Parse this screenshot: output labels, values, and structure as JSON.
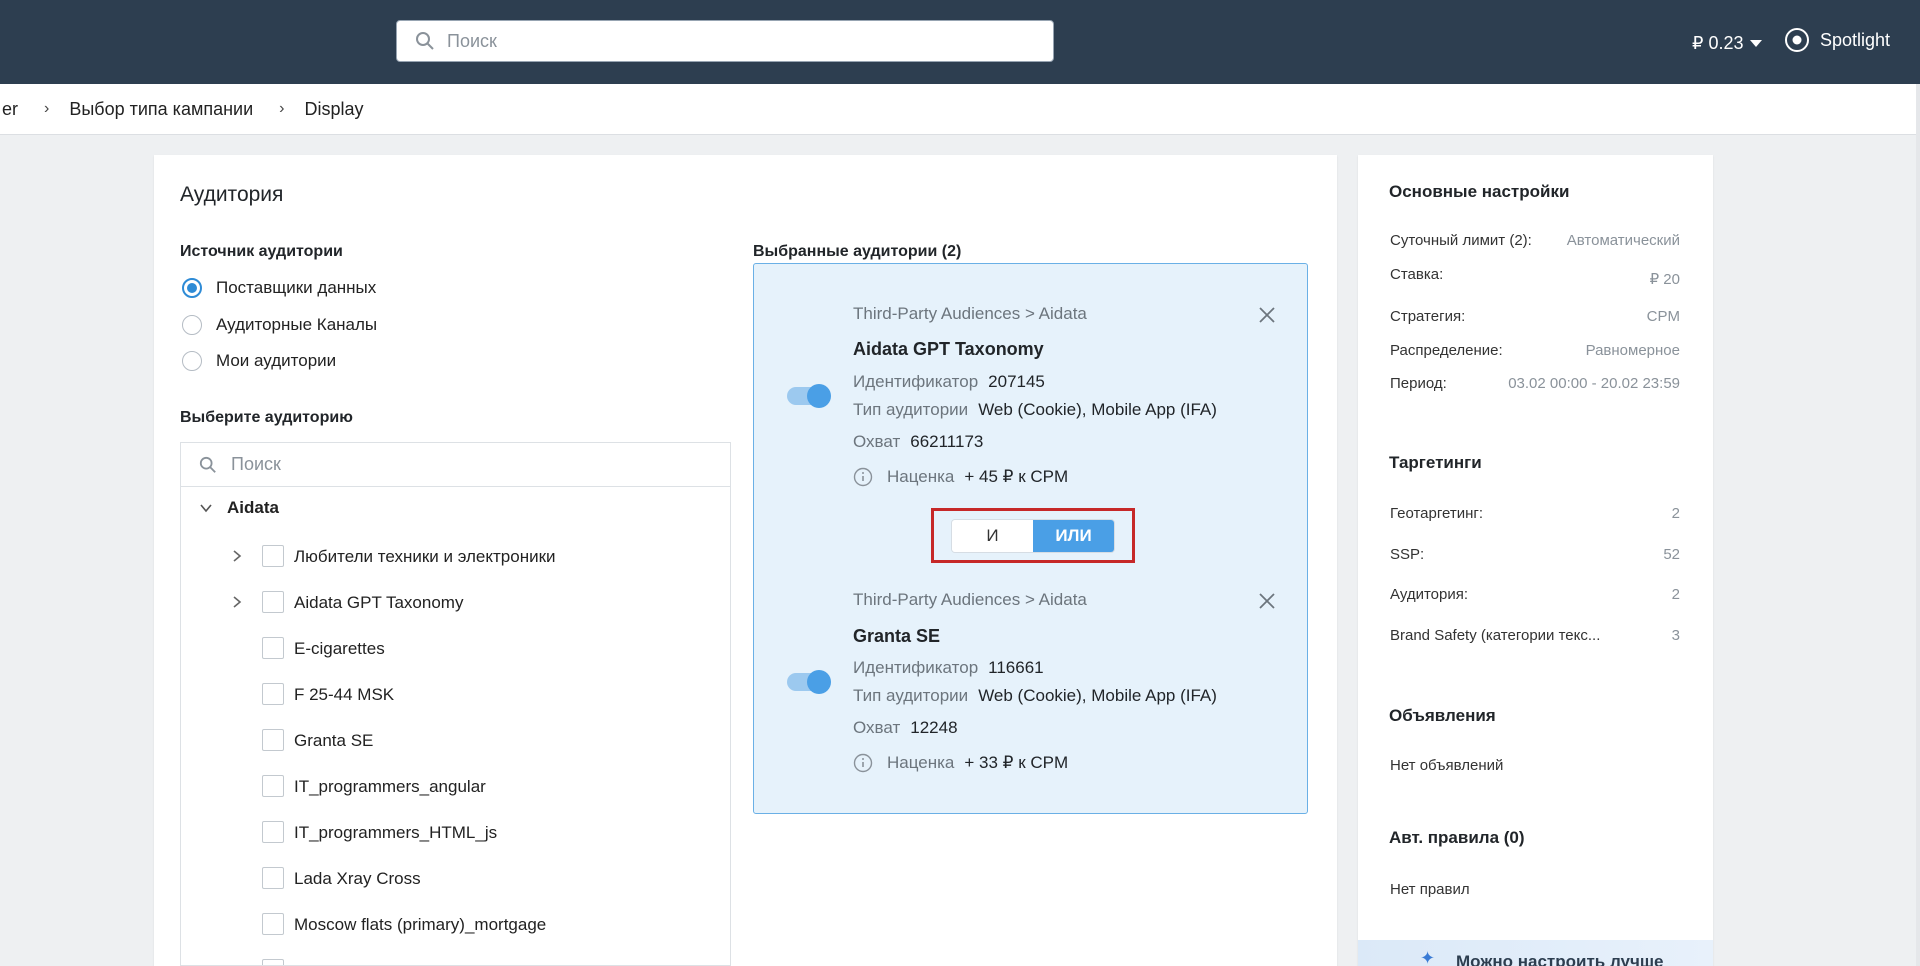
{
  "header": {
    "search_placeholder": "Поиск",
    "balance": "₽ 0.23",
    "spotlight": "Spotlight"
  },
  "breadcrumb": {
    "items": [
      "er",
      "Выбор типа кампании",
      "Display"
    ]
  },
  "audience": {
    "title": "Аудитория",
    "source_label": "Источник аудитории",
    "sources": [
      {
        "label": "Поставщики данных",
        "selected": true
      },
      {
        "label": "Аудиторные Каналы",
        "selected": false
      },
      {
        "label": "Мои аудитории",
        "selected": false
      }
    ],
    "choose_label": "Выберите аудиторию",
    "list_search_placeholder": "Поиск",
    "group": "Aidata",
    "items": [
      {
        "label": "Любители техники и электроники",
        "expandable": true
      },
      {
        "label": "Aidata GPT Taxonomy",
        "expandable": true
      },
      {
        "label": "E-cigarettes",
        "expandable": false
      },
      {
        "label": "F 25-44 MSK",
        "expandable": false
      },
      {
        "label": "Granta SE",
        "expandable": false
      },
      {
        "label": "IT_programmers_angular",
        "expandable": false
      },
      {
        "label": "IT_programmers_HTML_js",
        "expandable": false
      },
      {
        "label": "Lada Xray Cross",
        "expandable": false
      },
      {
        "label": "Moscow flats (primary)_mortgage",
        "expandable": false
      }
    ]
  },
  "selected": {
    "label": "Выбранные аудитории (2)",
    "logic": {
      "and": "И",
      "or": "ИЛИ",
      "active": "or"
    },
    "cards": [
      {
        "path": "Third-Party Audiences > Aidata",
        "name": "Aidata GPT Taxonomy",
        "id_label": "Идентификатор",
        "id_value": "207145",
        "type_label": "Тип аудитории",
        "type_value": "Web (Cookie), Mobile App (IFA)",
        "reach_label": "Охват",
        "reach_value": "66211173",
        "markup_label": "Наценка",
        "markup_value": "+ 45 ₽ к CPM"
      },
      {
        "path": "Third-Party Audiences > Aidata",
        "name": "Granta SE",
        "id_label": "Идентификатор",
        "id_value": "116661",
        "type_label": "Тип аудитории",
        "type_value": "Web (Cookie), Mobile App (IFA)",
        "reach_label": "Охват",
        "reach_value": "12248",
        "markup_label": "Наценка",
        "markup_value": "+ 33 ₽ к CPM"
      }
    ]
  },
  "sidebar": {
    "main_title": "Основные настройки",
    "main_rows": [
      {
        "k": "Суточный лимит (2):",
        "v": "Автоматический"
      },
      {
        "k": "Ставка:",
        "v": "₽ 20"
      },
      {
        "k": "Стратегия:",
        "v": "CPM"
      },
      {
        "k": "Распределение:",
        "v": "Равномерное"
      },
      {
        "k": "Период:",
        "v": "03.02 00:00 - 20.02 23:59"
      }
    ],
    "targeting_title": "Таргетинги",
    "targeting_rows": [
      {
        "k": "Геотаргетинг:",
        "v": "2"
      },
      {
        "k": "SSP:",
        "v": "52"
      },
      {
        "k": "Аудитория:",
        "v": "2"
      },
      {
        "k": "Brand Safety (категории текс...",
        "v": "3"
      }
    ],
    "ads_title": "Объявления",
    "ads_text": "Нет объявлений",
    "rules_title": "Авт. правила (0)",
    "rules_text": "Нет правил",
    "promo": "Можно настроить лучше"
  },
  "colors": {
    "topbar": "#2d3e50",
    "accent": "#4a9fe6",
    "highlight": "#c62828"
  }
}
